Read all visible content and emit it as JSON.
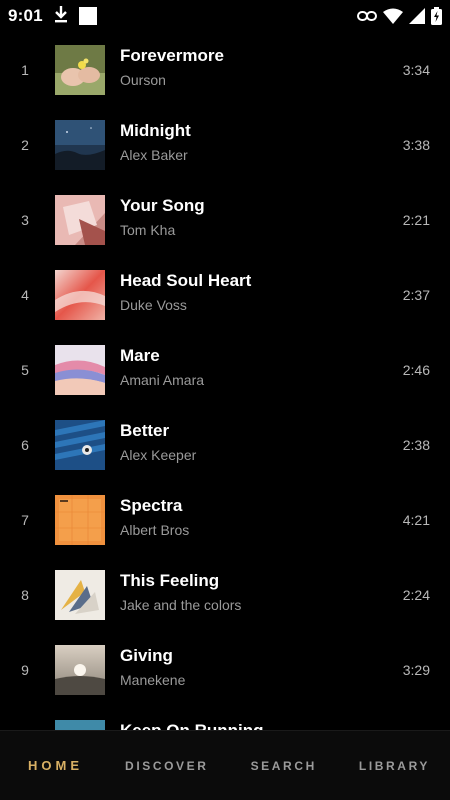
{
  "status_bar": {
    "time": "9:01"
  },
  "tracks": [
    {
      "index": "1",
      "title": "Forevermore",
      "artist": "Ourson",
      "duration": "3:34"
    },
    {
      "index": "2",
      "title": "Midnight",
      "artist": "Alex Baker",
      "duration": "3:38"
    },
    {
      "index": "3",
      "title": "Your Song",
      "artist": "Tom Kha",
      "duration": "2:21"
    },
    {
      "index": "4",
      "title": "Head Soul Heart",
      "artist": "Duke Voss",
      "duration": "2:37"
    },
    {
      "index": "5",
      "title": "Mare",
      "artist": "Amani Amara",
      "duration": "2:46"
    },
    {
      "index": "6",
      "title": "Better",
      "artist": "Alex Keeper",
      "duration": "2:38"
    },
    {
      "index": "7",
      "title": "Spectra",
      "artist": "Albert Bros",
      "duration": "4:21"
    },
    {
      "index": "8",
      "title": "This Feeling",
      "artist": "Jake and the colors",
      "duration": "2:24"
    },
    {
      "index": "9",
      "title": "Giving",
      "artist": "Manekene",
      "duration": "3:29"
    },
    {
      "index": "",
      "title": "Keep On Running",
      "artist": "",
      "duration": ""
    }
  ],
  "nav": {
    "home": "HOME",
    "discover": "DISCOVER",
    "search": "SEARCH",
    "library": "LIBRARY"
  },
  "colors": {
    "accent": "#d8b064",
    "background": "#000000",
    "secondary_text": "#9a9a9a"
  }
}
